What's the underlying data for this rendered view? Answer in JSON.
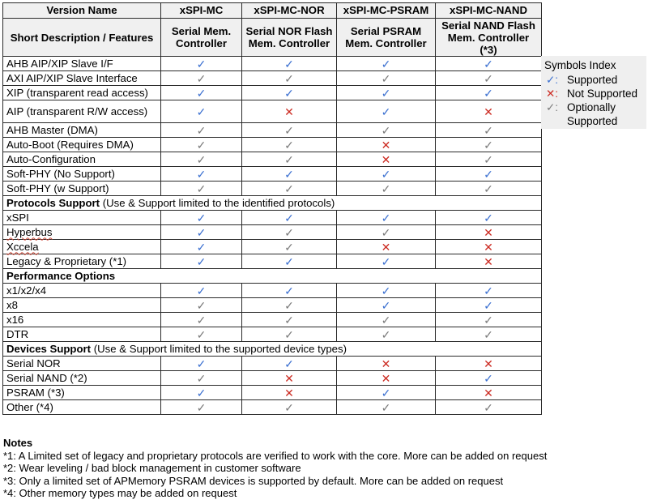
{
  "header": {
    "version_label": "Version Name",
    "description_label": "Short Description / Features",
    "versions": [
      {
        "name": "xSPI-MC",
        "description": "Serial Mem. Controller"
      },
      {
        "name": "xSPI-MC-NOR",
        "description": "Serial NOR Flash Mem. Controller"
      },
      {
        "name": "xSPI-MC-PSRAM",
        "description": "Serial PSRAM Mem. Controller"
      },
      {
        "name": "xSPI-MC-NAND",
        "description": "Serial NAND Flash Mem. Controller (*3)"
      }
    ]
  },
  "symbols": {
    "supported": {
      "glyph": "✓",
      "color": "#3a6fd0"
    },
    "not_supported": {
      "glyph": "✕",
      "color": "#cc2b22"
    },
    "optional": {
      "glyph": "✓",
      "color": "#7a7a7a"
    }
  },
  "sections": [
    {
      "title": "",
      "subtitle": "",
      "rows": [
        {
          "feature": "AHB AIP/XIP Slave I/F",
          "values": [
            "supported",
            "supported",
            "supported",
            "supported"
          ]
        },
        {
          "feature": "AXI AIP/XIP Slave Interface",
          "values": [
            "optional",
            "optional",
            "optional",
            "optional"
          ]
        },
        {
          "feature": "XIP (transparent read access)",
          "values": [
            "supported",
            "supported",
            "supported",
            "supported"
          ]
        },
        {
          "feature": "AIP (transparent R/W access)",
          "values": [
            "supported",
            "not_supported",
            "supported",
            "not_supported"
          ],
          "tall": true
        },
        {
          "feature": "AHB Master (DMA)",
          "values": [
            "optional",
            "optional",
            "optional",
            "optional"
          ]
        },
        {
          "feature": "Auto-Boot (Requires DMA)",
          "values": [
            "optional",
            "optional",
            "not_supported",
            "optional"
          ]
        },
        {
          "feature": "Auto-Configuration",
          "values": [
            "optional",
            "optional",
            "not_supported",
            "optional"
          ]
        },
        {
          "feature": "Soft-PHY (No Support)",
          "values": [
            "supported",
            "supported",
            "supported",
            "supported"
          ]
        },
        {
          "feature": "Soft-PHY (w Support)",
          "values": [
            "optional",
            "optional",
            "optional",
            "optional"
          ]
        }
      ]
    },
    {
      "title": "Protocols Support",
      "subtitle": " (Use & Support limited to the identified protocols)",
      "rows": [
        {
          "feature": "xSPI",
          "values": [
            "supported",
            "supported",
            "supported",
            "supported"
          ]
        },
        {
          "feature": "Hyperbus",
          "values": [
            "supported",
            "optional",
            "optional",
            "not_supported"
          ],
          "squiggle": true
        },
        {
          "feature": "Xccela",
          "values": [
            "supported",
            "optional",
            "not_supported",
            "not_supported"
          ],
          "squiggle": true
        },
        {
          "feature": "Legacy & Proprietary (*1)",
          "values": [
            "supported",
            "supported",
            "supported",
            "not_supported"
          ]
        }
      ]
    },
    {
      "title": "Performance Options",
      "subtitle": "",
      "rows": [
        {
          "feature": "x1/x2/x4",
          "values": [
            "supported",
            "supported",
            "supported",
            "supported"
          ]
        },
        {
          "feature": "x8",
          "values": [
            "optional",
            "optional",
            "supported",
            "supported"
          ]
        },
        {
          "feature": "x16",
          "values": [
            "optional",
            "optional",
            "optional",
            "optional"
          ]
        },
        {
          "feature": "DTR",
          "values": [
            "optional",
            "optional",
            "optional",
            "optional"
          ]
        }
      ]
    },
    {
      "title": "Devices Support",
      "subtitle": " (Use & Support limited to the supported device types)",
      "rows": [
        {
          "feature": "Serial NOR",
          "values": [
            "supported",
            "supported",
            "not_supported",
            "not_supported"
          ]
        },
        {
          "feature": "Serial NAND (*2)",
          "values": [
            "optional",
            "not_supported",
            "not_supported",
            "supported"
          ]
        },
        {
          "feature": "PSRAM (*3)",
          "values": [
            "supported",
            "not_supported",
            "supported",
            "not_supported"
          ]
        },
        {
          "feature": "Other (*4)",
          "values": [
            "optional",
            "optional",
            "optional",
            "optional"
          ]
        }
      ]
    }
  ],
  "legend": {
    "title": "Symbols Index",
    "items": [
      {
        "symbol": "supported",
        "label": "Supported"
      },
      {
        "symbol": "not_supported",
        "label": "Not Supported"
      },
      {
        "symbol": "optional",
        "label": "Optionally Supported"
      }
    ]
  },
  "notes": {
    "title": "Notes",
    "items": [
      "*1: A Limited set of legacy and proprietary protocols are verified to work with the core. More can be added on request",
      "*2: Wear leveling / bad block management in customer software",
      "*3: Only a limited set of APMemory PSRAM devices is supported by default. More can be added on request",
      "*4: Other memory types may be added on request"
    ]
  }
}
